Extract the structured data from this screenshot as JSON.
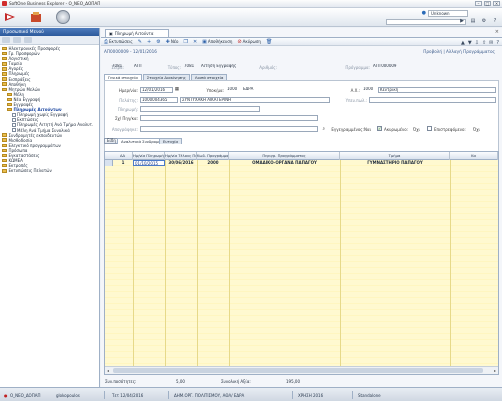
{
  "window": {
    "title": "SoftOne Business Explorer - Ο_ΝΕΟ_ΔΟΠΑΠ"
  },
  "ribbon": {
    "user": "Unknown"
  },
  "sidebar": {
    "title": "Προσωπικό Μενού",
    "items": [
      {
        "label": "Ηλεκτρονικές Προσφορές",
        "indent": 1,
        "kind": "folder"
      },
      {
        "label": "Γρ. Προσφορών",
        "indent": 1,
        "kind": "folder"
      },
      {
        "label": "Λογιστική",
        "indent": 1,
        "kind": "folder"
      },
      {
        "label": "Ταμείο",
        "indent": 1,
        "kind": "folder"
      },
      {
        "label": "Αγορές",
        "indent": 1,
        "kind": "folder"
      },
      {
        "label": "Πληρωμές",
        "indent": 1,
        "kind": "folder"
      },
      {
        "label": "Εισπράξεις",
        "indent": 1,
        "kind": "folder"
      },
      {
        "label": "Αποθήκη",
        "indent": 1,
        "kind": "folder"
      },
      {
        "label": "Μητρώο Μελών",
        "indent": 1,
        "kind": "folder"
      },
      {
        "label": "Μέλη",
        "indent": 2,
        "kind": "folder"
      },
      {
        "label": "Νέα Εγγραφή",
        "indent": 2,
        "kind": "folder"
      },
      {
        "label": "Εγγραφές",
        "indent": 2,
        "kind": "folder"
      },
      {
        "label": "Πληρωμές Αιτούντων",
        "indent": 2,
        "kind": "folder",
        "selected": true
      },
      {
        "label": "Πληρωμή χωρίς Εγγραφή",
        "indent": 3,
        "kind": "doc"
      },
      {
        "label": "Εκπτώσεις",
        "indent": 3,
        "kind": "doc"
      },
      {
        "label": "Πληρωμές Αιτητή Ανά Τμήμα Αναλυτ.",
        "indent": 3,
        "kind": "doc"
      },
      {
        "label": "Μέλη Ανά Τμήμα Συνολικά",
        "indent": 3,
        "kind": "doc"
      },
      {
        "label": "Συνδρομητές εκπαιδευτών",
        "indent": 1,
        "kind": "folder"
      },
      {
        "label": "Μισθοδοσία",
        "indent": 1,
        "kind": "folder"
      },
      {
        "label": "Ελεγκτικό προγραμμάτων",
        "indent": 1,
        "kind": "folder"
      },
      {
        "label": "Πρόσωπα",
        "indent": 1,
        "kind": "folder"
      },
      {
        "label": "Εγκαταστάσεις",
        "indent": 1,
        "kind": "folder"
      },
      {
        "label": "ΚΩΜΕΑ",
        "indent": 1,
        "kind": "folder"
      },
      {
        "label": "Εκτροπές",
        "indent": 1,
        "kind": "folder"
      },
      {
        "label": "Εκτυπώσεις Πελατών",
        "indent": 1,
        "kind": "folder"
      }
    ]
  },
  "doc_tab": {
    "label": "Πληρωμή Αιτούντα"
  },
  "toolbar": {
    "buttons": [
      {
        "label": "Εκτυπώσεις",
        "icon": "print-icon"
      },
      {
        "label": "",
        "icon": "tools-icon"
      },
      {
        "label": "",
        "icon": "plus-icon"
      },
      {
        "label": "",
        "icon": "gear-icon"
      },
      {
        "label": "Νέο",
        "icon": "new-icon"
      },
      {
        "label": "",
        "icon": "copy-icon"
      },
      {
        "label": "",
        "icon": "x-icon"
      },
      {
        "label": "Αποθήκευση",
        "icon": "save-icon"
      },
      {
        "label": "Ακύρωση",
        "icon": "cancel-icon",
        "red": true
      },
      {
        "label": "",
        "icon": "delete-icon"
      }
    ]
  },
  "header": {
    "code": "ΑΠ0000009 - 12/01/2016",
    "right": "Προβολή | Αλλαγή Προγράμματος"
  },
  "row1": {
    "series_label": "Σειρά:",
    "series_value": "7081",
    "type_value": "ΑΠΤ",
    "type_label": "Τύπος:",
    "type2_value": "7081",
    "type_desc": "Αίτηση Εγγραφής",
    "num_label": "Αριθμός:",
    "prog_label": "Πρόγραμμα:",
    "prog_value": "ΑΠΤ000009"
  },
  "tabs": [
    "Γενικά στοιχεία",
    "Στοιχεία Διακίνησης",
    "Λοιπά στοιχεία"
  ],
  "form": {
    "date_label": "Ημερ/νία:",
    "date_value": "12/01/2016",
    "branch_label": "Υποκ/μα:",
    "branch_value": "1000",
    "branch_name": "ΕΔΡΑ",
    "ak_label": "Α.Χ.:",
    "ak_value": "1000",
    "ak_name": "Κεντρική",
    "member_label": "Πελάτης:",
    "member_code": "1000004365",
    "member_name": "ΣΥΝΤΥΧΑΚΗ ΑΙΚΑΤΕΡΙΝΗ",
    "salesman_label": "Υπευ.πωλ.:",
    "payment_label": "Πληρωμή:",
    "ref_label": "Σχ/ Πηγ/κα:",
    "note_label": "Απογράφηκε:",
    "enrolled_label": "Εγγεγραμμένος:",
    "enrolled_value": "Ναι",
    "reg_label": "Ακυρωμένο:",
    "reg_value": "Όχι",
    "ver_label": "Επιστρεφόμενο:",
    "ver_value": "Όχι"
  },
  "detail_tabs": [
    "Είδη",
    "Αναλυτικά Συνδρομών",
    "Ευτυχία"
  ],
  "grid": {
    "columns": [
      "ΑΑ",
      "Ημ/νία Πληρωμής",
      "Ημ/νία Τέλους Πε",
      "Κωδ. Προγράμματος",
      "Περιγρ. Προγράμματος",
      "Τμήμα",
      "Κα"
    ],
    "rows": [
      {
        "aa": "1",
        "pay_date": "01/10/2015",
        "end_date": "30/06/2016",
        "prog_code": "2000",
        "prog_desc": "ΟΜΑΔΙΚΟ-ΟΡΓΑΝΑ ΠΑΠΑΓΟΥ",
        "dept": "ΓΥΜΝΑΣΤΗΡΙΟ ΠΑΠΑΓΟΥ"
      }
    ]
  },
  "totals": {
    "qty_label": "Συν.ποσότητες:",
    "qty_value": "5,00",
    "value_label": "Συνολική Αξία:",
    "value_value": "195,00"
  },
  "status": {
    "db": "Ο_ΝΕΟ_ΔΟΠΑΠ",
    "user": "glokopoulos",
    "datetime": "Τετ 12/04/2016",
    "company": "ΔΗΜ.ΟΡΓ. ΠΟΛΙΤΙΣΜΟΥ, ΑΘΛ/ ΕΔΡΑ",
    "year": "ΧΡΗΣΗ 2016",
    "mode": "Standalone"
  },
  "colors": {
    "accent": "#2d5a9c",
    "grid_row": "#fff9d0"
  }
}
